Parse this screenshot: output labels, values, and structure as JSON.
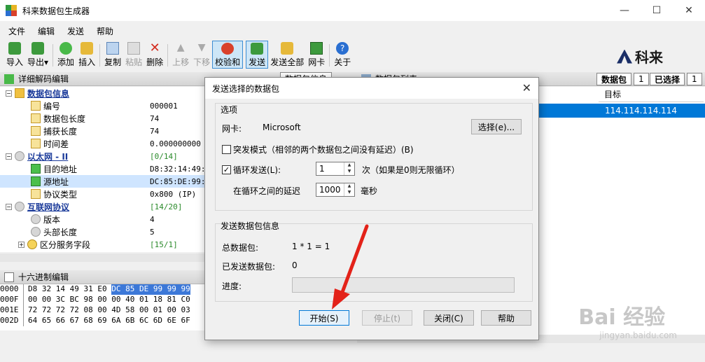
{
  "window": {
    "title": "科来数据包生成器",
    "min": "—",
    "max": "☐",
    "close": "✕"
  },
  "menu": [
    "文件",
    "编辑",
    "发送",
    "帮助"
  ],
  "toolbar": [
    {
      "label": "导入"
    },
    {
      "label": "导出▾"
    },
    {
      "label": "添加"
    },
    {
      "label": "插入"
    },
    {
      "label": "复制"
    },
    {
      "label": "粘贴"
    },
    {
      "label": "删除"
    },
    {
      "label": "上移"
    },
    {
      "label": "下移"
    },
    {
      "label": "校验和"
    },
    {
      "label": "发送"
    },
    {
      "label": "发送全部"
    },
    {
      "label": "网卡"
    },
    {
      "label": "关于"
    }
  ],
  "brand": "科来",
  "decode_panel": {
    "title": "详细解码编辑",
    "tab": "数据包信息"
  },
  "tree": [
    {
      "label": "数据包信息",
      "value": ""
    },
    {
      "label": "编号",
      "value": "000001"
    },
    {
      "label": "数据包长度",
      "value": "74"
    },
    {
      "label": "捕获长度",
      "value": "74"
    },
    {
      "label": "时间差",
      "value": "0.000000000"
    },
    {
      "label": "以太网 - II",
      "value": "[0/14]"
    },
    {
      "label": "目的地址",
      "value": "D8:32:14:49:"
    },
    {
      "label": "源地址",
      "value": "DC:85:DE:99:"
    },
    {
      "label": "协议类型",
      "value": "0x800  (IP)"
    },
    {
      "label": "互联网协议",
      "value": "[14/20]"
    },
    {
      "label": "版本",
      "value": "4"
    },
    {
      "label": "头部长度",
      "value": "5"
    },
    {
      "label": "区分服务字段",
      "value": "[15/1]"
    }
  ],
  "hex_panel": {
    "title": "十六进制编辑"
  },
  "hex": [
    {
      "offset": "0000",
      "pre": "D8 32 14 49 31 E0 ",
      "hl": "DC 85 DE 99 99 99",
      "post": ""
    },
    {
      "offset": "000F",
      "pre": "00 00 3C BC 98 00 00 40 01 18 81 C0",
      "hl": "",
      "post": ""
    },
    {
      "offset": "001E",
      "pre": "72 72 72 72 08 00 4D 58 00 01 00 03",
      "hl": "",
      "post": ""
    },
    {
      "offset": "002D",
      "pre": "64 65 66 67 68 69 6A 6B 6C 6D 6E 6F",
      "hl": "",
      "post": ""
    }
  ],
  "list_panel": {
    "title": "数据包列表",
    "packets_label": "数据包",
    "packets_count": "1",
    "selected_label": "已选择",
    "selected_count": "1",
    "col_target": "目标",
    "row_target": "114.114.114.114"
  },
  "dialog": {
    "title": "发送选择的数据包",
    "options_legend": "选项",
    "nic_label": "网卡:",
    "nic_value": "Microsoft",
    "select_btn": "选择(e)...",
    "burst_label": "突发模式（相邻的两个数据包之间没有延迟）(B)",
    "burst_checked": false,
    "loop_label": "循环发送(L):",
    "loop_checked": true,
    "loop_value": "1",
    "loop_suffix": "次（如果是0则无限循环）",
    "delay_label": "在循环之间的延迟",
    "delay_value": "1000",
    "delay_unit": "毫秒",
    "info_legend": "发送数据包信息",
    "total_label": "总数据包:",
    "total_value": "1 * 1 = 1",
    "sent_label": "已发送数据包:",
    "sent_value": "0",
    "progress_label": "进度:",
    "progress_fraction": 0,
    "start_btn": "开始(S)",
    "stop_btn": "停止(t)",
    "close_btn": "关闭(C)",
    "help_btn": "帮助"
  },
  "watermark": {
    "big": "Bai 经验",
    "small": "jingyan.baidu.com"
  }
}
